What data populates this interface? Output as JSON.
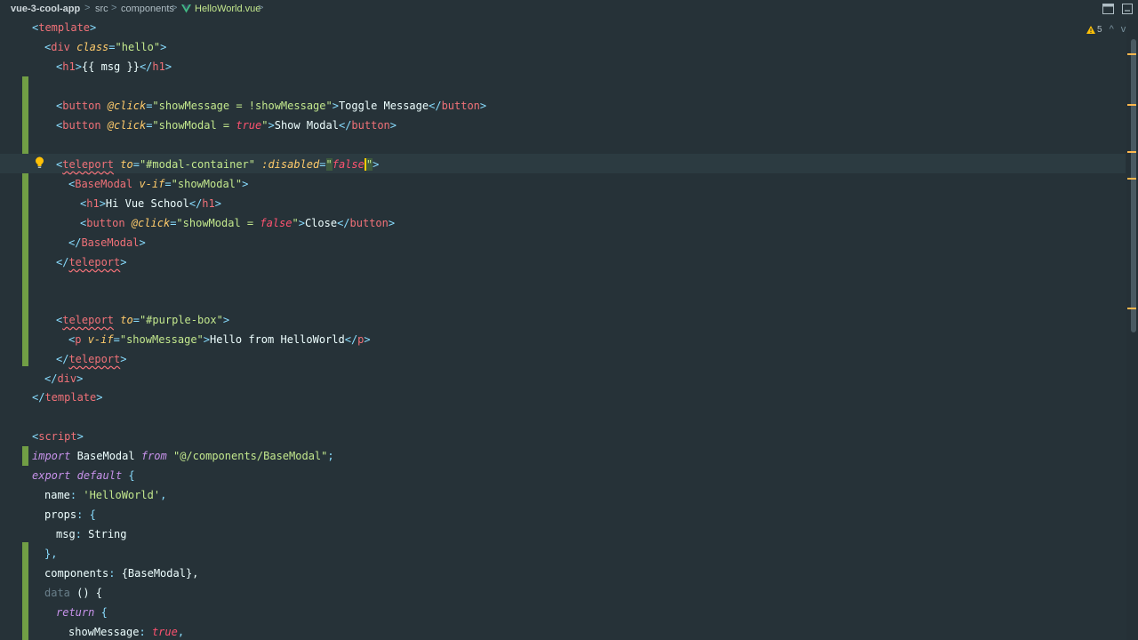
{
  "breadcrumb": {
    "project": "vue-3-cool-app",
    "folder1": "src",
    "folder2": "components",
    "file": "HelloWorld.vue",
    "separator": ">"
  },
  "inspections": {
    "warning_count": "5",
    "up": "^",
    "down": "v"
  },
  "code": {
    "l1": {
      "o": "<",
      "tag": "template",
      "c": ">"
    },
    "l2": {
      "o": "<",
      "tag": "div",
      "attr": "class",
      "eq": "=",
      "val": "\"hello\"",
      "c": ">"
    },
    "l3": {
      "o": "<",
      "tag": "h1",
      "c": ">",
      "text": "{{ msg }}",
      "o2": "</",
      "tag2": "h1",
      "c2": ">"
    },
    "l5": {
      "o": "<",
      "tag": "button",
      "attr": "@click",
      "eq": "=",
      "val": "\"showMessage = !showMessage\"",
      "c": ">",
      "text": "Toggle Message",
      "o2": "</",
      "tag2": "button",
      "c2": ">"
    },
    "l6": {
      "o": "<",
      "tag": "button",
      "attr": "@click",
      "eq": "=",
      "val_start": "\"showModal = ",
      "val_bool": "true",
      "val_end": "\"",
      "c": ">",
      "text": "Show Modal",
      "o2": "</",
      "tag2": "button",
      "c2": ">"
    },
    "l8": {
      "o": "<",
      "tag": "teleport",
      "attr": "to",
      "eq": "=",
      "val": "\"#modal-container\"",
      "attr2": ":disabled",
      "eq2": "=",
      "q1": "\"",
      "bool": "false",
      "q2": "\"",
      "c": ">"
    },
    "l9": {
      "o": "<",
      "tag": "BaseModal",
      "attr": "v-if",
      "eq": "=",
      "val": "\"showModal\"",
      "c": ">"
    },
    "l10": {
      "o": "<",
      "tag": "h1",
      "c": ">",
      "text": "Hi Vue School",
      "o2": "</",
      "tag2": "h1",
      "c2": ">"
    },
    "l11": {
      "o": "<",
      "tag": "button",
      "attr": "@click",
      "eq": "=",
      "val_start": "\"showModal = ",
      "val_bool": "false",
      "val_end": "\"",
      "c": ">",
      "text": "Close",
      "o2": "</",
      "tag2": "button",
      "c2": ">"
    },
    "l12": {
      "o": "</",
      "tag": "BaseModal",
      "c": ">"
    },
    "l13": {
      "o": "</",
      "tag": "teleport",
      "c": ">"
    },
    "l16": {
      "o": "<",
      "tag": "teleport",
      "attr": "to",
      "eq": "=",
      "val": "\"#purple-box\"",
      "c": ">"
    },
    "l17": {
      "o": "<",
      "tag": "p",
      "attr": "v-if",
      "eq": "=",
      "val": "\"showMessage\"",
      "c": ">",
      "text": "Hello from HelloWorld",
      "o2": "</",
      "tag2": "p",
      "c2": ">"
    },
    "l18": {
      "o": "</",
      "tag": "teleport",
      "c": ">"
    },
    "l19": {
      "o": "</",
      "tag": "div",
      "c": ">"
    },
    "l20": {
      "o": "</",
      "tag": "template",
      "c": ">"
    },
    "l22": {
      "o": "<",
      "tag": "script",
      "c": ">"
    },
    "l23": {
      "kw": "import",
      "name": " BaseModal ",
      "from": "from",
      "str": " \"@/components/BaseModal\"",
      "semi": ";"
    },
    "l24": {
      "kw": "export",
      "sp": " ",
      "kw2": "default",
      "brace": " {"
    },
    "l25": {
      "key": "name",
      "colon": ": ",
      "str": "'HelloWorld'",
      "comma": ","
    },
    "l26": {
      "key": "props",
      "colon": ": ",
      "brace": "{"
    },
    "l27": {
      "key": "msg",
      "colon": ": ",
      "val": "String"
    },
    "l28": {
      "brace": "},"
    },
    "l29": {
      "key": "components",
      "colon": ": ",
      "val": "{BaseModal},"
    },
    "l30": {
      "key": "data",
      "rest": " () {"
    },
    "l31": {
      "kw": "return",
      "brace": " {"
    },
    "l32": {
      "key": "showMessage",
      "colon": ": ",
      "bool": "true",
      "comma": ","
    }
  }
}
